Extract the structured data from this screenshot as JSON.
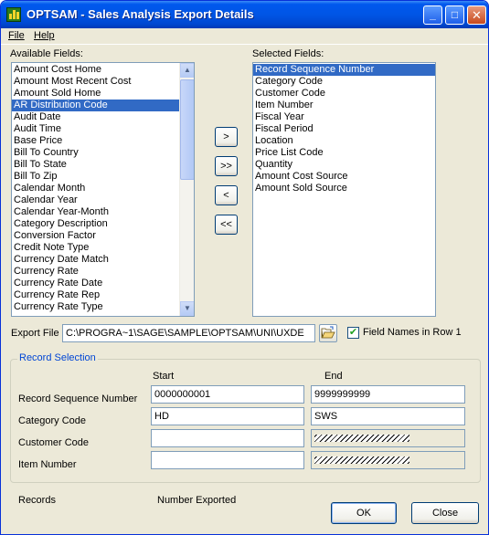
{
  "window": {
    "title": "OPTSAM  -  Sales Analysis Export Details",
    "minimize_glyph": "_",
    "maximize_glyph": "□",
    "close_glyph": "✕"
  },
  "menu": {
    "file": "File",
    "help": "Help"
  },
  "available": {
    "label": "Available Fields:",
    "items": [
      "Amount Cost Home",
      "Amount Most Recent Cost",
      "Amount Sold Home",
      "AR Distribution Code",
      "Audit Date",
      "Audit Time",
      "Base Price",
      "Bill To Country",
      "Bill To State",
      "Bill To Zip",
      "Calendar Month",
      "Calendar Year",
      "Calendar Year-Month",
      "Category Description",
      "Conversion Factor",
      "Credit Note Type",
      "Currency Date Match",
      "Currency Rate",
      "Currency Rate Date",
      "Currency Rate Rep",
      "Currency Rate Type"
    ],
    "selected_index": 3
  },
  "selected": {
    "label": "Selected Fields:",
    "items": [
      "Record Sequence Number",
      "Category Code",
      "Customer Code",
      "Item Number",
      "Fiscal Year",
      "Fiscal Period",
      "Location",
      "Price List Code",
      "Quantity",
      "Amount Cost Source",
      "Amount Sold Source"
    ],
    "selected_index": 0
  },
  "move_buttons": {
    "add": ">",
    "add_all": ">>",
    "remove": "<",
    "remove_all": "<<"
  },
  "export": {
    "label": "Export File",
    "path": "C:\\PROGRA~1\\SAGE\\SAMPLE\\OPTSAM\\UNI\\UXDE",
    "field_names_label": "Field Names in Row 1",
    "field_names_checked": true
  },
  "record_selection": {
    "title": "Record Selection",
    "start_header": "Start",
    "end_header": "End",
    "rows": [
      {
        "label": "Record Sequence Number",
        "start": "0000000001",
        "end": "9999999999"
      },
      {
        "label": "Category Code",
        "start": "HD",
        "end": "SWS"
      },
      {
        "label": "Customer Code",
        "start": "",
        "end": ""
      },
      {
        "label": "Item Number",
        "start": "",
        "end": ""
      }
    ]
  },
  "footer": {
    "records_label": "Records",
    "number_exported_label": "Number Exported",
    "ok_label": "OK",
    "close_label": "Close"
  }
}
